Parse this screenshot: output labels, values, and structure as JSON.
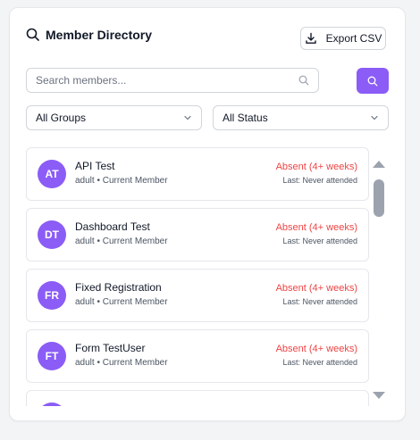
{
  "header": {
    "title": "Member Directory",
    "export_label": "Export CSV"
  },
  "search": {
    "placeholder": "Search members...",
    "value": ""
  },
  "filters": {
    "group": "All Groups",
    "status": "All Status"
  },
  "colors": {
    "accent": "#8b5cf6",
    "absent": "#ef4444"
  },
  "members": [
    {
      "initials": "AT",
      "name": "API Test",
      "meta": "adult • Current Member",
      "status": "Absent (4+ weeks)",
      "last": "Last: Never attended"
    },
    {
      "initials": "DT",
      "name": "Dashboard Test",
      "meta": "adult • Current Member",
      "status": "Absent (4+ weeks)",
      "last": "Last: Never attended"
    },
    {
      "initials": "FR",
      "name": "Fixed Registration",
      "meta": "adult • Current Member",
      "status": "Absent (4+ weeks)",
      "last": "Last: Never attended"
    },
    {
      "initials": "FT",
      "name": "Form TestUser",
      "meta": "adult • Current Member",
      "status": "Absent (4+ weeks)",
      "last": "Last: Never attended"
    }
  ]
}
